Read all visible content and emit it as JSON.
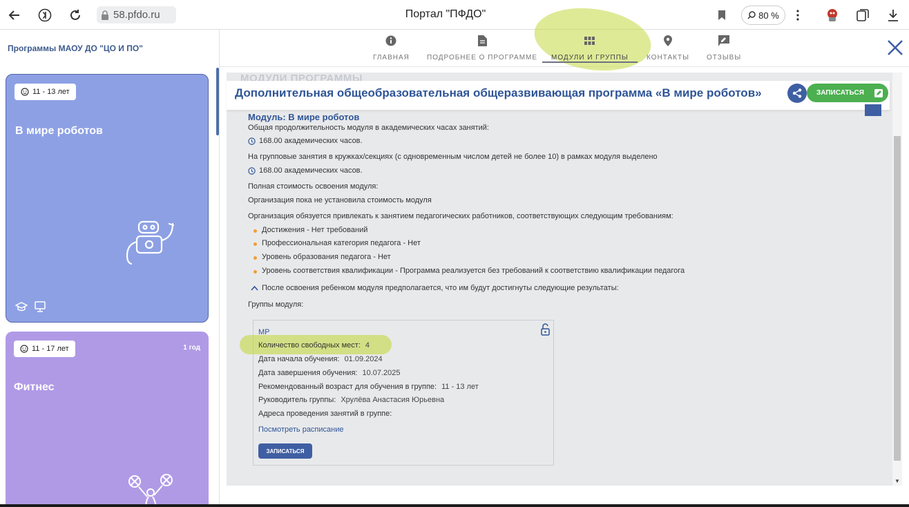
{
  "browser": {
    "url": "58.pfdo.ru",
    "title": "Портал \"ПФДО\"",
    "zoom": "80 %"
  },
  "sidebar": {
    "title": "Программы МАОУ ДО \"ЦО И ПО\"",
    "cards": [
      {
        "age": "11 - 13 лет",
        "title": "В мире роботов",
        "duration": ""
      },
      {
        "age": "11 - 17 лет",
        "title": "Фитнес",
        "duration": "1 год"
      }
    ]
  },
  "tabs": [
    {
      "label": "ГЛАВНАЯ",
      "icon": "info-icon"
    },
    {
      "label": "ПОДРОБНЕЕ О ПРОГРАММЕ",
      "icon": "document-icon"
    },
    {
      "label": "МОДУЛИ И ГРУППЫ",
      "icon": "grid-icon",
      "active": true
    },
    {
      "label": "КОНТАКТЫ",
      "icon": "location-pin-icon"
    },
    {
      "label": "ОТЗЫВЫ",
      "icon": "review-icon"
    }
  ],
  "content": {
    "ghost_heading": "МОДУЛИ ПРОГРАММЫ",
    "program_title": "Дополнительная общеобразовательная общеразвивающая программа «В мире роботов»",
    "enroll_label": "ЗАПИСАТЬСЯ",
    "module": {
      "title": "Модуль: В мире роботов",
      "duration_label": "Общая продолжительность модуля в академических часах занятий:",
      "duration_value": "168.00 академических часов.",
      "group_hours_label": "На групповые занятия в кружках/секциях (с одновременным числом детей не более 10) в рамках модуля выделено",
      "group_hours_value": "168.00 академических часов.",
      "cost_label": "Полная стоимость освоения модуля:",
      "cost_value": "Организация пока не установила стоимость модуля",
      "requirements_label": "Организация обязуется привлекать к занятием педагогических работников, соответствующих следующим требованиям:",
      "requirements": [
        "Достижения - Нет требований",
        "Профессиональная категория педагога - Нет",
        "Уровень образования педагога - Нет",
        "Уровень соответствия квалификации - Программа реализуется без требований к соответствию квалификации педагога"
      ],
      "results_label": "После освоения ребенком модуля предполагается, что им будут достигнуты следующие результаты:",
      "groups_label": "Группы модуля:"
    },
    "group": {
      "name": "МР",
      "free_places_label": "Количество свободных мест:",
      "free_places_value": "4",
      "start_label": "Дата начала обучения:",
      "start_value": "01.09.2024",
      "end_label": "Дата завершения обучения:",
      "end_value": "10.07.2025",
      "age_label": "Рекомендованный возраст для обучения в группе:",
      "age_value": "11 - 13 лет",
      "leader_label": "Руководитель группы:",
      "leader_value": "Хрулёва Анастасия Юрьевна",
      "address_label": "Адреса проведения занятий в группе:",
      "schedule_link": "Посмотреть расписание",
      "enroll_label": "ЗАПИСАТЬСЯ"
    }
  },
  "colors": {
    "brand_blue": "#2f5597",
    "button_blue": "#3f5fa3",
    "enroll_green": "#4caf50",
    "card1": "#8da0e4",
    "card2": "#b09ae6",
    "bullet": "#f29e34",
    "highlight": "#c4d841"
  }
}
